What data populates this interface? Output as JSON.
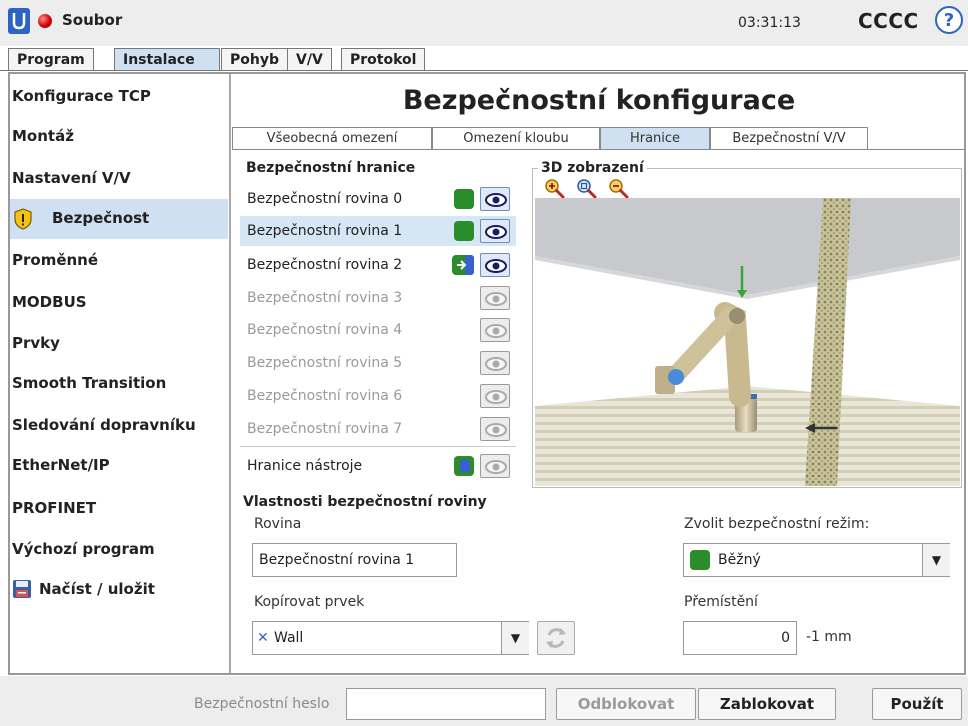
{
  "titlebar": {
    "menu_file": "Soubor",
    "clock": "03:31:13",
    "robot_name": "CCCC",
    "help_label": "?"
  },
  "main_tabs": [
    {
      "label": "Program",
      "active": false
    },
    {
      "label": "Instalace",
      "active": true
    },
    {
      "label": "Pohyb",
      "active": false
    },
    {
      "label": "V/V",
      "active": false
    },
    {
      "label": "Protokol",
      "active": false
    }
  ],
  "sidebar": {
    "items": [
      {
        "label": "Konfigurace TCP"
      },
      {
        "label": "Montáž"
      },
      {
        "label": "Nastavení V/V"
      },
      {
        "label": "Bezpečnost",
        "active": true,
        "icon": "warning-shield-icon"
      },
      {
        "label": "Proměnné"
      },
      {
        "label": "MODBUS"
      },
      {
        "label": "Prvky"
      },
      {
        "label": "Smooth Transition"
      },
      {
        "label": "Sledování dopravníku"
      },
      {
        "label": "EtherNet/IP"
      },
      {
        "label": "PROFINET"
      },
      {
        "label": "Výchozí program"
      },
      {
        "label": "Načíst / uložit",
        "icon": "save-disk-icon"
      }
    ]
  },
  "page_title": "Bezpečnostní konfigurace",
  "sub_tabs": [
    {
      "label": "Všeobecná omezení",
      "active": false
    },
    {
      "label": "Omezení kloubu",
      "active": false
    },
    {
      "label": "Hranice",
      "active": true
    },
    {
      "label": "Bezpečnostní V/V",
      "active": false
    }
  ],
  "boundaries": {
    "heading": "Bezpečnostní hranice",
    "planes": [
      {
        "label": "Bezpečnostní rovina 0",
        "mode": "normal",
        "visible": true
      },
      {
        "label": "Bezpečnostní rovina 1",
        "mode": "normal",
        "visible": true,
        "selected": true
      },
      {
        "label": "Bezpečnostní rovina 2",
        "mode": "trigger",
        "visible": true
      },
      {
        "label": "Bezpečnostní rovina 3",
        "mode": "disabled",
        "visible": false
      },
      {
        "label": "Bezpečnostní rovina 4",
        "mode": "disabled",
        "visible": false
      },
      {
        "label": "Bezpečnostní rovina 5",
        "mode": "disabled",
        "visible": false
      },
      {
        "label": "Bezpečnostní rovina 6",
        "mode": "disabled",
        "visible": false
      },
      {
        "label": "Bezpečnostní rovina 7",
        "mode": "disabled",
        "visible": false
      }
    ],
    "tool_boundary": {
      "label": "Hranice nástroje",
      "mode": "tool",
      "visible": false
    }
  },
  "view3d": {
    "legend": "3D zobrazení",
    "zoom_icons": [
      "zoom-in-icon",
      "zoom-fit-icon",
      "zoom-out-icon"
    ]
  },
  "properties": {
    "heading": "Vlastnosti bezpečnostní roviny",
    "plane_label": "Rovina",
    "plane_value": "Bezpečnostní rovina 1",
    "copy_feature_label": "Kopírovat prvek",
    "copy_feature_value": "Wall",
    "mode_label": "Zvolit bezpečnostní režim:",
    "mode_value": "Běžný",
    "displacement_label": "Přemístění",
    "displacement_value": "0",
    "displacement_unit": "-1 mm"
  },
  "bottom": {
    "password_label": "Bezpečnostní heslo",
    "password_value": "",
    "unlock_label": "Odblokovat",
    "lock_label": "Zablokovat",
    "apply_label": "Použít"
  },
  "colors": {
    "accent": "#cfe0f2",
    "normal_mode": "#2a8c2a",
    "error_dot": "#d40000"
  }
}
